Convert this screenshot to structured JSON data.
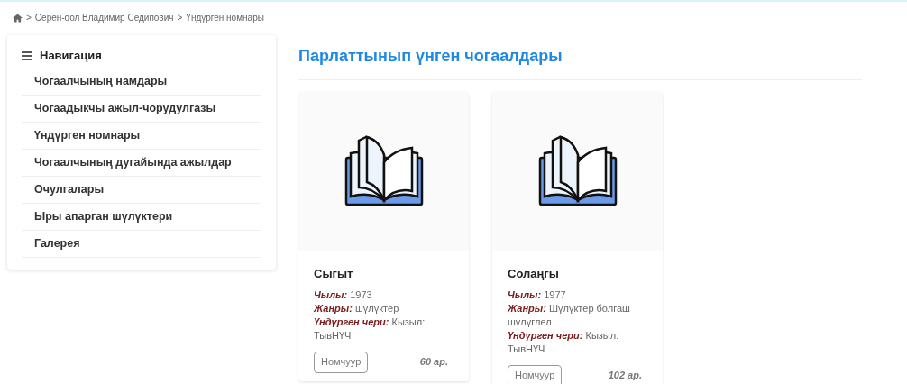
{
  "breadcrumb": {
    "items": [
      "Серен-оол Владимир Седипович",
      "Үндүрген номнары"
    ],
    "separator": ">"
  },
  "sidebar": {
    "title": "Навигация",
    "items": [
      "Чогаалчының намдары",
      "Чогаадыкчы ажыл-чорудулгазы",
      "Үндүрген номнары",
      "Чогаалчының дугайында ажылдар",
      "Очулгалары",
      "Ыры апарган шүлүктери",
      "Галерея"
    ]
  },
  "main": {
    "title": "Парлаттынып үнген чогаалдары",
    "books": [
      {
        "title": "Сыгыт",
        "details": [
          "**Чылы:** 1973",
          "**Жанры:** шүлүктер",
          "**Үндүрген чери:** Кызыл: ТывНҮЧ"
        ],
        "button": "Номчуур",
        "pages": "60 ар."
      },
      {
        "title": "Солаңгы",
        "details": [
          "**Чылы:** 1977",
          "**Жанры:** Шүлүктер болгаш шүлүглел",
          "**Үндүрген чери:** Кызыл: ТывНҮЧ"
        ],
        "button": "Номчуур",
        "pages": "102 ар."
      }
    ]
  }
}
